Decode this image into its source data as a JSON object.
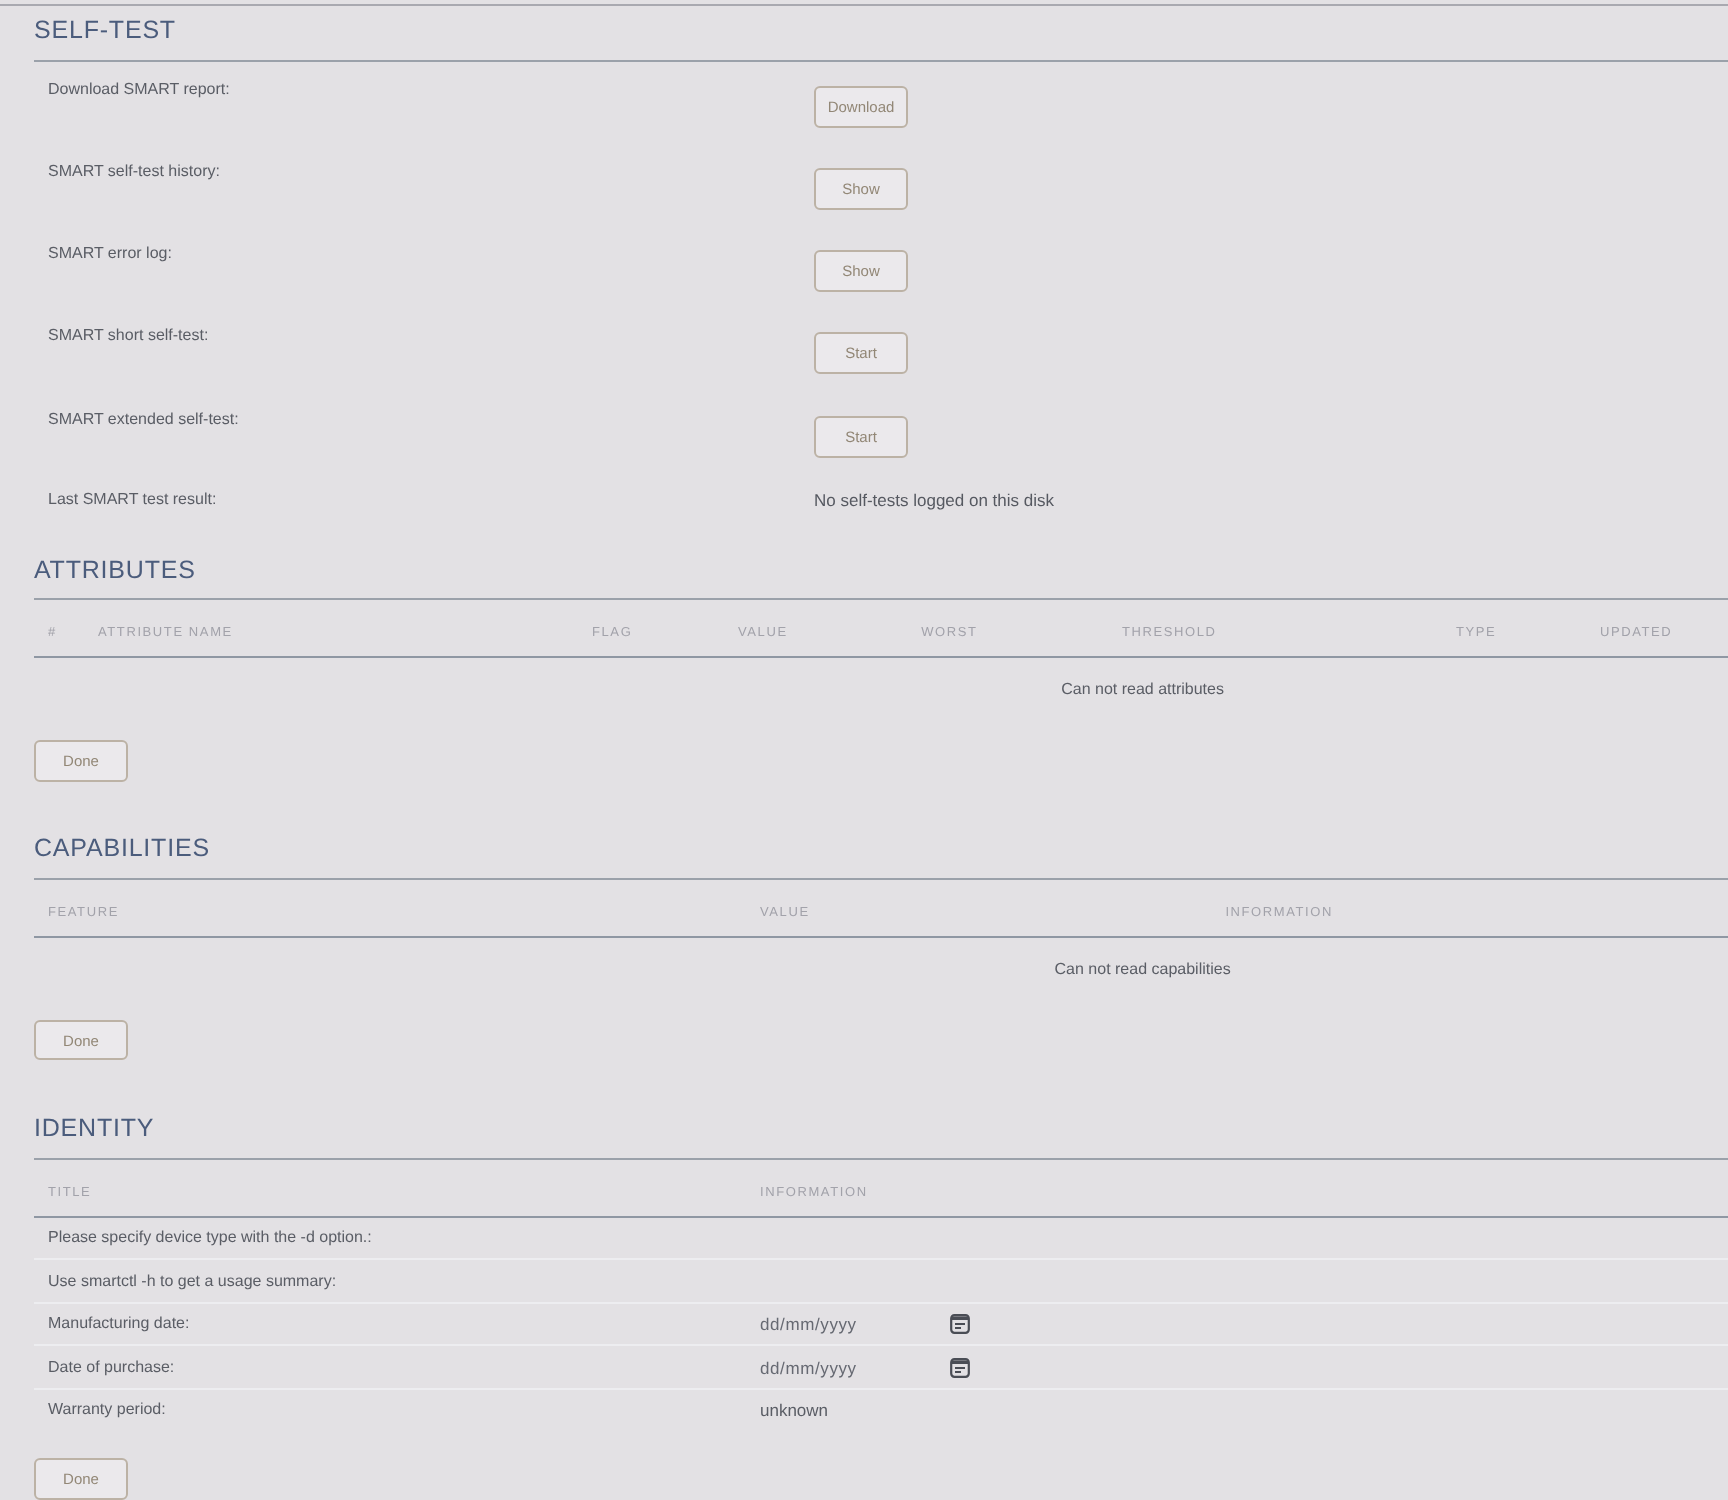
{
  "self_test": {
    "title": "SELF-TEST",
    "rows": [
      {
        "kind": "button",
        "label": "Download SMART report:",
        "button": "Download"
      },
      {
        "kind": "button",
        "label": "SMART self-test history:",
        "button": "Show"
      },
      {
        "kind": "button",
        "label": "SMART error log:",
        "button": "Show"
      },
      {
        "kind": "button",
        "label": "SMART short self-test:",
        "button": "Start"
      },
      {
        "kind": "button",
        "label": "SMART extended self-test:",
        "button": "Start"
      },
      {
        "kind": "text",
        "label": "Last SMART test result:",
        "value": "No self-tests logged on this disk"
      }
    ]
  },
  "attributes": {
    "title": "ATTRIBUTES",
    "columns": [
      "#",
      "ATTRIBUTE NAME",
      "FLAG",
      "VALUE",
      "WORST",
      "THRESHOLD",
      "TYPE",
      "UPDATED"
    ],
    "message": "Can not read attributes",
    "button": "Done"
  },
  "capabilities": {
    "title": "CAPABILITIES",
    "columns": [
      "FEATURE",
      "VALUE",
      "INFORMATION"
    ],
    "message": "Can not read capabilities",
    "button": "Done"
  },
  "identity": {
    "title": "IDENTITY",
    "columns": [
      "TITLE",
      "INFORMATION"
    ],
    "rows": [
      {
        "kind": "text",
        "title": "Please specify device type with the -d option.:"
      },
      {
        "kind": "text",
        "title": "Use smartctl -h to get a usage summary:"
      },
      {
        "kind": "date",
        "title": "Manufacturing date:",
        "placeholder": "dd/mm/yyyy"
      },
      {
        "kind": "date",
        "title": "Date of purchase:",
        "placeholder": "dd/mm/yyyy"
      },
      {
        "kind": "text",
        "title": "Warranty period:",
        "value": "unknown"
      }
    ],
    "button": "Done"
  }
}
